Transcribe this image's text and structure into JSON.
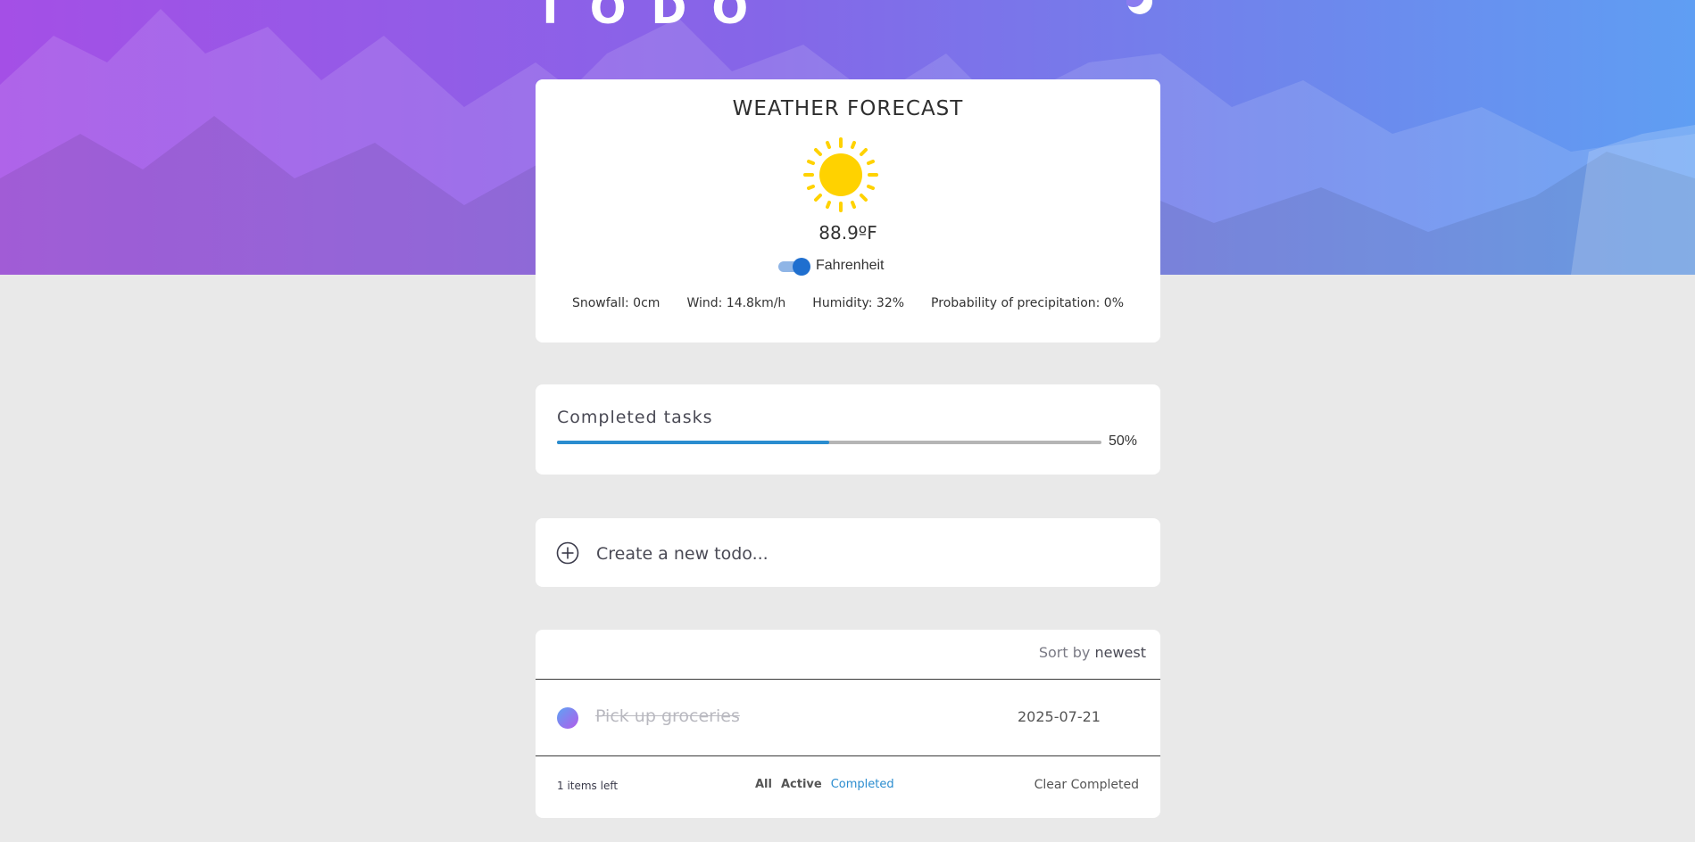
{
  "header": {
    "title": "TODO",
    "theme_icon": "moon-icon"
  },
  "weather": {
    "title": "WEATHER FORECAST",
    "icon": "sun-icon",
    "temperature": "88.9ºF",
    "unit_label": "Fahrenheit",
    "unit_toggle_on": true,
    "stats": {
      "snowfall": "Snowfall: 0cm",
      "wind": "Wind: 14.8km/h",
      "humidity": "Humidity: 32%",
      "precipitation": "Probability of precipitation: 0%"
    }
  },
  "progress": {
    "title": "Completed tasks",
    "percent_label": "50%",
    "fraction": 0.5
  },
  "new_todo": {
    "placeholder": "Create a new todo...",
    "icon": "plus-circle-icon"
  },
  "list": {
    "sort_prefix": "Sort by",
    "sort_value": "newest",
    "items": [
      {
        "text": "Pick up groceries",
        "date": "2025-07-21",
        "completed": true
      }
    ],
    "items_left": "1 items left",
    "filters": [
      "All",
      "Active",
      "Completed"
    ],
    "active_filter": "Completed",
    "clear_label": "Clear Completed"
  },
  "colors": {
    "accent": "#2a8ccf",
    "hero_start": "#a44fe6",
    "hero_end": "#5f9ef3",
    "sun": "#ffd200"
  }
}
